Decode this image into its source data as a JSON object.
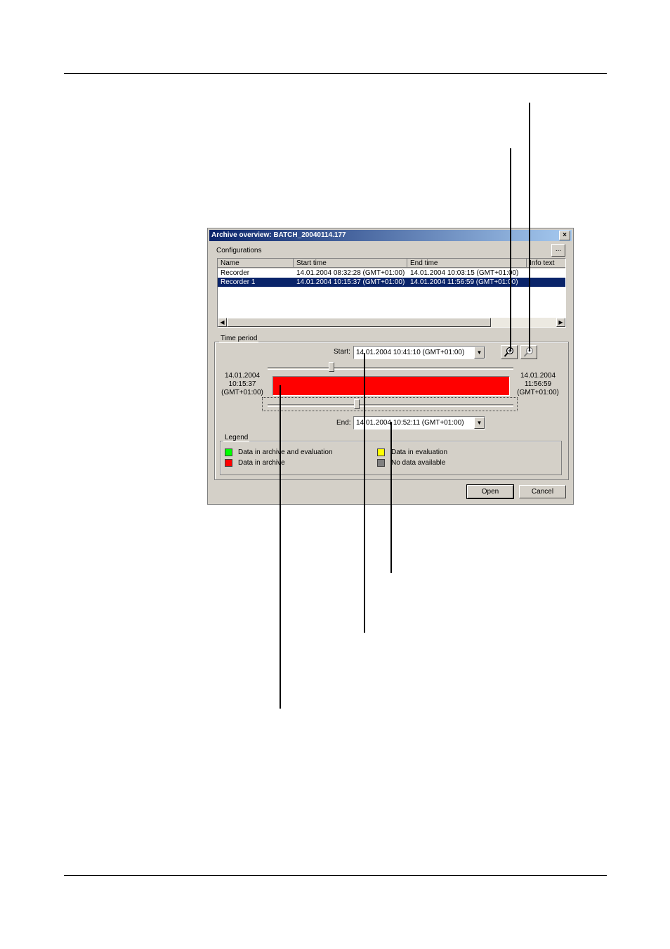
{
  "dialog": {
    "title": "Archive overview: BATCH_20040114.177",
    "close": "×",
    "configurations_label": "Configurations",
    "browse_button": "...",
    "columns": [
      "Name",
      "Start time",
      "End time",
      "Info text"
    ],
    "rows": [
      {
        "name": "Recorder",
        "start": "14.01.2004 08:32:28 (GMT+01:00)",
        "end": "14.01.2004 10:03:15 (GMT+01:00)",
        "info": ""
      },
      {
        "name": "Recorder 1",
        "start": "14.01.2004 10:15:37 (GMT+01:00)",
        "end": "14.01.2004 11:56:59 (GMT+01:00)",
        "info": "",
        "selected": true
      }
    ],
    "time_period": {
      "label": "Time period",
      "start_label": "Start:",
      "start_value": "14.01.2004 10:41:10    (GMT+01:00)",
      "end_label": "End:",
      "end_value": "14.01.2004 10:52:11    (GMT+01:00)",
      "range_start": [
        "14.01.2004",
        "10:15:37",
        "(GMT+01:00)"
      ],
      "range_end": [
        "14.01.2004",
        "11:56:59",
        "(GMT+01:00)"
      ],
      "bar_color": "#ff0000",
      "zoom_in_icon": "zoom-in-icon",
      "zoom_out_icon": "zoom-out-icon"
    },
    "legend": {
      "label": "Legend",
      "items": [
        {
          "text": "Data in archive and evaluation",
          "color": "#00ff00"
        },
        {
          "text": "Data in archive",
          "color": "#ff0000"
        },
        {
          "text": "Data in evaluation",
          "color": "#ffff00"
        },
        {
          "text": "No data available",
          "color": "#808080"
        }
      ]
    },
    "open_button": "Open",
    "cancel_button": "Cancel"
  }
}
